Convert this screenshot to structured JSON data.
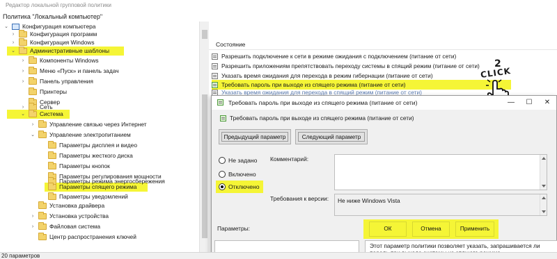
{
  "app": {
    "titlebar": "Редактор локальной групповой политики",
    "root": "Политика \"Локальный компьютер\""
  },
  "tree": {
    "items": [
      {
        "label": "Конфигурация компьютера",
        "icon": "computer-config-icon"
      },
      {
        "label": "Конфигурация программ",
        "icon": "folder-icon"
      },
      {
        "label": "Конфигурация Windows",
        "icon": "folder-icon"
      },
      {
        "label": "Административные шаблоны",
        "icon": "folder-icon"
      },
      {
        "label": "Компоненты Windows",
        "icon": "folder-icon"
      },
      {
        "label": "Меню «Пуск» и панель задач",
        "icon": "folder-icon"
      },
      {
        "label": "Панель управления",
        "icon": "folder-icon"
      },
      {
        "label": "Принтеры",
        "icon": "folder-icon"
      },
      {
        "label": "Сервер",
        "icon": "folder-icon"
      },
      {
        "label": "Сеть",
        "icon": "folder-icon"
      },
      {
        "label": "Система",
        "icon": "folder-icon"
      },
      {
        "label": "Управление связью через Интернет",
        "icon": "folder-icon"
      },
      {
        "label": "Управление электропитанием",
        "icon": "folder-icon"
      },
      {
        "label": "Параметры дисплея и видео",
        "icon": "folder-icon"
      },
      {
        "label": "Параметры жесткого диска",
        "icon": "folder-icon"
      },
      {
        "label": "Параметры кнопок",
        "icon": "folder-icon"
      },
      {
        "label": "Параметры регулирования мощности",
        "icon": "folder-icon"
      },
      {
        "label": "Параметры режима энергосбережения",
        "icon": "folder-icon"
      },
      {
        "label": "Параметры спящего режима",
        "icon": "folder-icon"
      },
      {
        "label": "Параметры уведомлений",
        "icon": "folder-icon"
      },
      {
        "label": "Установка драйвера",
        "icon": "folder-icon"
      },
      {
        "label": "Установка устройства",
        "icon": "folder-icon"
      },
      {
        "label": "Файловая система",
        "icon": "folder-icon"
      },
      {
        "label": "Центр распространения ключей",
        "icon": "folder-icon"
      }
    ]
  },
  "list": {
    "header": "Состояние",
    "rows": [
      "Разрешить подключение к сети в режиме ожидания с подключением (питание от сети)",
      "Разрешить приложениям препятствовать переходу системы в спящий режим (питание от сети)",
      "Указать время ожидания для перехода в режим гибернации (питание от сети)",
      "Требовать пароль при выходе из спящего режима (питание от сети)",
      "Указать время ожидания для перехода в спящий режим (питание от сети)"
    ]
  },
  "annotation": {
    "number": "2",
    "text": "CLICK"
  },
  "dialog": {
    "title": "Требовать пароль при выходе из спящего режима (питание от сети)",
    "subtitle": "Требовать пароль при выходе из спящего режима (питание от сети)",
    "prev_button": "Предыдущий параметр",
    "next_button": "Следующий параметр",
    "radio_not_configured": "Не задано",
    "radio_enabled": "Включено",
    "radio_disabled": "Отключено",
    "comment_label": "Комментарий:",
    "supported_label": "Требования к версии:",
    "supported_value": "Не ниже Windows Vista",
    "options_label": "Параметры:",
    "ok_button": "ОК",
    "cancel_button": "Отмена",
    "apply_button": "Применить",
    "help_text": "Этот параметр политики позволяет указать, запрашивается ли пароль при выходе системы из спящего режима."
  },
  "status": {
    "text": "20 параметров"
  },
  "colors": {
    "highlight": "#f5f536",
    "folder": "#f3d36b"
  }
}
